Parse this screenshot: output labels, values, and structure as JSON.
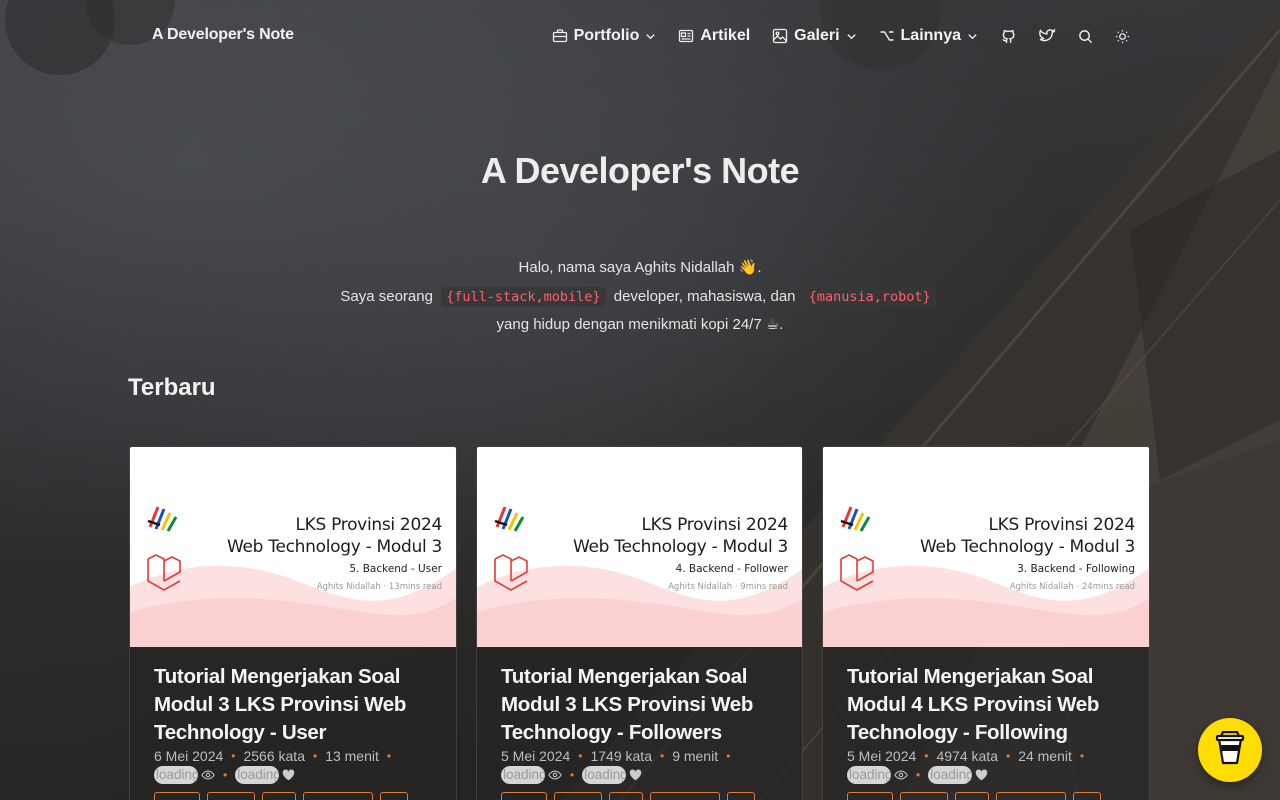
{
  "header": {
    "brand": "A Developer's Note",
    "nav": [
      {
        "label": "Portfolio",
        "icon": "briefcase-icon",
        "dropdown": true
      },
      {
        "label": "Artikel",
        "icon": "newspaper-icon",
        "dropdown": false
      },
      {
        "label": "Galeri",
        "icon": "image-icon",
        "dropdown": true
      },
      {
        "label": "Lainnya",
        "icon": "option-icon",
        "dropdown": true
      }
    ],
    "icons": [
      "github-icon",
      "twitter-icon",
      "search-icon",
      "sun-icon"
    ]
  },
  "hero": {
    "title": "A Developer's Note",
    "line1": "Halo, nama saya Aghits Nidallah 👋.",
    "line2_prefix": "Saya seorang",
    "line2_code1": "{full-stack,mobile}",
    "line2_middle": "developer, mahasiswa, dan",
    "line2_code2": "{manusia,robot}",
    "line3": "yang hidup dengan menikmati kopi 24/7 ☕."
  },
  "section": {
    "title": "Terbaru"
  },
  "cards": [
    {
      "thumb_title1": "LKS Provinsi 2024",
      "thumb_title2": "Web Technology - Modul 3",
      "thumb_sub": "5. Backend - User",
      "thumb_meta": "Aghits Nidallah · 13mins read",
      "title": "Tutorial Mengerjakan Soal Modul 3 LKS Provinsi Web Technology - User",
      "date": "6 Mei 2024",
      "words": "2566 kata",
      "time": "13 menit",
      "views": "loading",
      "likes": "loading",
      "tag_count": 5
    },
    {
      "thumb_title1": "LKS Provinsi 2024",
      "thumb_title2": "Web Technology - Modul 3",
      "thumb_sub": "4. Backend - Follower",
      "thumb_meta": "Aghits Nidallah · 9mins read",
      "title": "Tutorial Mengerjakan Soal Modul 3 LKS Provinsi Web Technology - Followers",
      "date": "5 Mei 2024",
      "words": "1749 kata",
      "time": "9 menit",
      "views": "loading",
      "likes": "loading",
      "tag_count": 5
    },
    {
      "thumb_title1": "LKS Provinsi 2024",
      "thumb_title2": "Web Technology - Modul 3",
      "thumb_sub": "3. Backend - Following",
      "thumb_meta": "Aghits Nidallah · 24mins read",
      "title": "Tutorial Mengerjakan Soal Modul 4 LKS Provinsi Web Technology - Following",
      "date": "5 Mei 2024",
      "words": "4974 kata",
      "time": "24 menit",
      "views": "loading",
      "likes": "loading",
      "tag_count": 5
    }
  ],
  "colors": {
    "accent": "#e07b39",
    "code": "#ff5f6d",
    "coffee_button": "#ffdd00"
  },
  "floating": {
    "icon": "coffee-cup-icon"
  }
}
